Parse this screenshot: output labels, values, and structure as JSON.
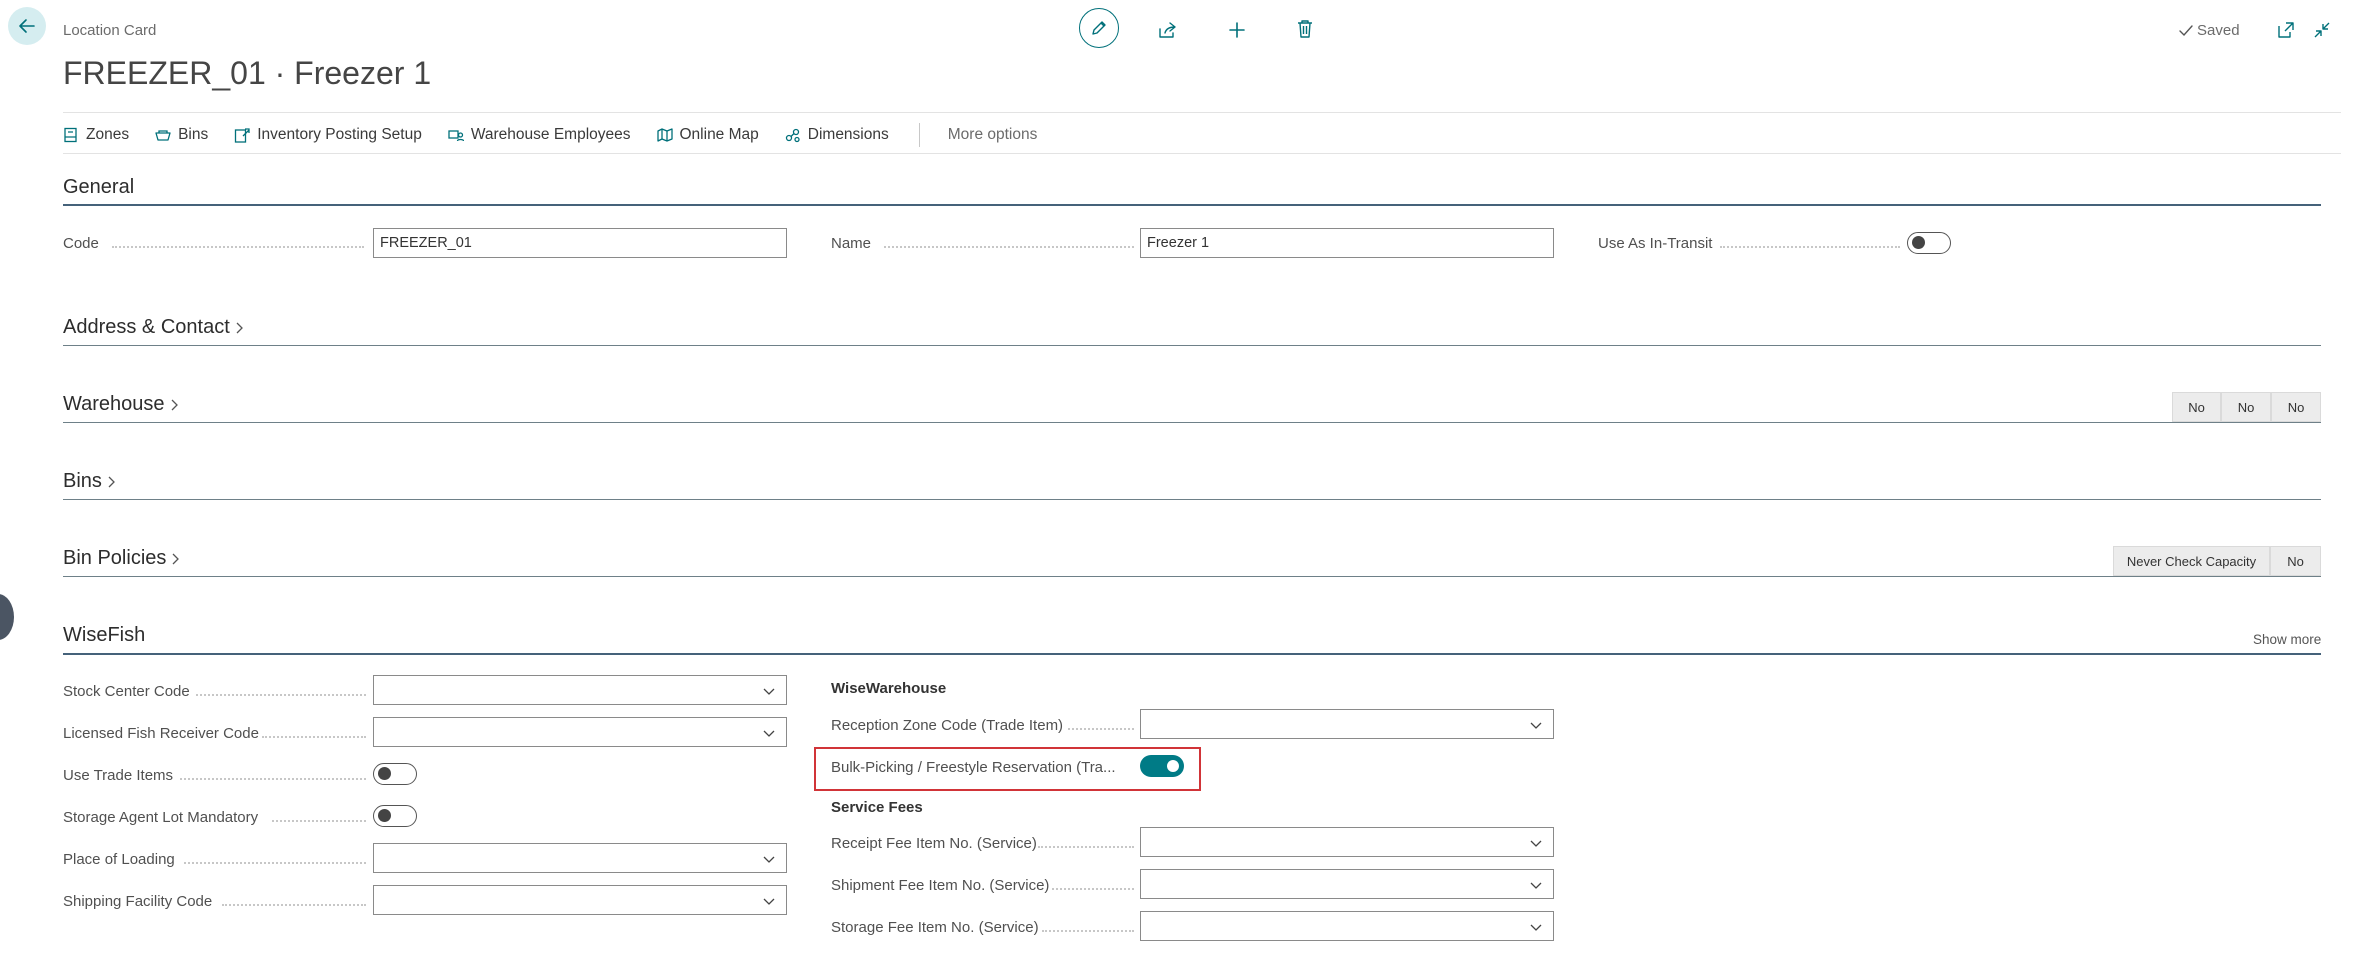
{
  "header": {
    "page_type": "Location Card",
    "title": "FREEZER_01 · Freezer 1",
    "saved_label": "Saved"
  },
  "actions": {
    "items": [
      {
        "label": "Zones",
        "icon": "zones-icon"
      },
      {
        "label": "Bins",
        "icon": "bins-icon"
      },
      {
        "label": "Inventory Posting Setup",
        "icon": "inventory-posting-icon"
      },
      {
        "label": "Warehouse Employees",
        "icon": "warehouse-employees-icon"
      },
      {
        "label": "Online Map",
        "icon": "online-map-icon"
      },
      {
        "label": "Dimensions",
        "icon": "dimensions-icon"
      }
    ],
    "more_label": "More options"
  },
  "general": {
    "title": "General",
    "code_label": "Code",
    "code_value": "FREEZER_01",
    "name_label": "Name",
    "name_value": "Freezer 1",
    "in_transit_label": "Use As In-Transit",
    "in_transit_value": false
  },
  "address": {
    "title": "Address & Contact"
  },
  "warehouse": {
    "title": "Warehouse",
    "summary": [
      "No",
      "No",
      "No"
    ]
  },
  "bins": {
    "title": "Bins"
  },
  "bin_policies": {
    "title": "Bin Policies",
    "summary": [
      "Never Check Capacity",
      "No"
    ]
  },
  "wisefish": {
    "title": "WiseFish",
    "show_more": "Show more",
    "left": {
      "stock_center_label": "Stock Center Code",
      "licensed_receiver_label": "Licensed Fish Receiver Code",
      "use_trade_items_label": "Use Trade Items",
      "storage_agent_label": "Storage Agent Lot Mandatory",
      "place_of_loading_label": "Place of Loading",
      "shipping_facility_label": "Shipping Facility Code"
    },
    "wisewarehouse_heading": "WiseWarehouse",
    "reception_zone_label": "Reception Zone Code (Trade Item)",
    "bulk_picking_label": "Bulk-Picking / Freestyle Reservation (Tra...",
    "bulk_picking_value": true,
    "service_fees_heading": "Service Fees",
    "receipt_fee_label": "Receipt Fee Item No. (Service)",
    "shipment_fee_label": "Shipment Fee Item No. (Service)",
    "storage_fee_label": "Storage Fee Item No. (Service)"
  },
  "colors": {
    "accent": "#00707a",
    "toggle_on": "#007b86",
    "highlight": "#d13438"
  }
}
